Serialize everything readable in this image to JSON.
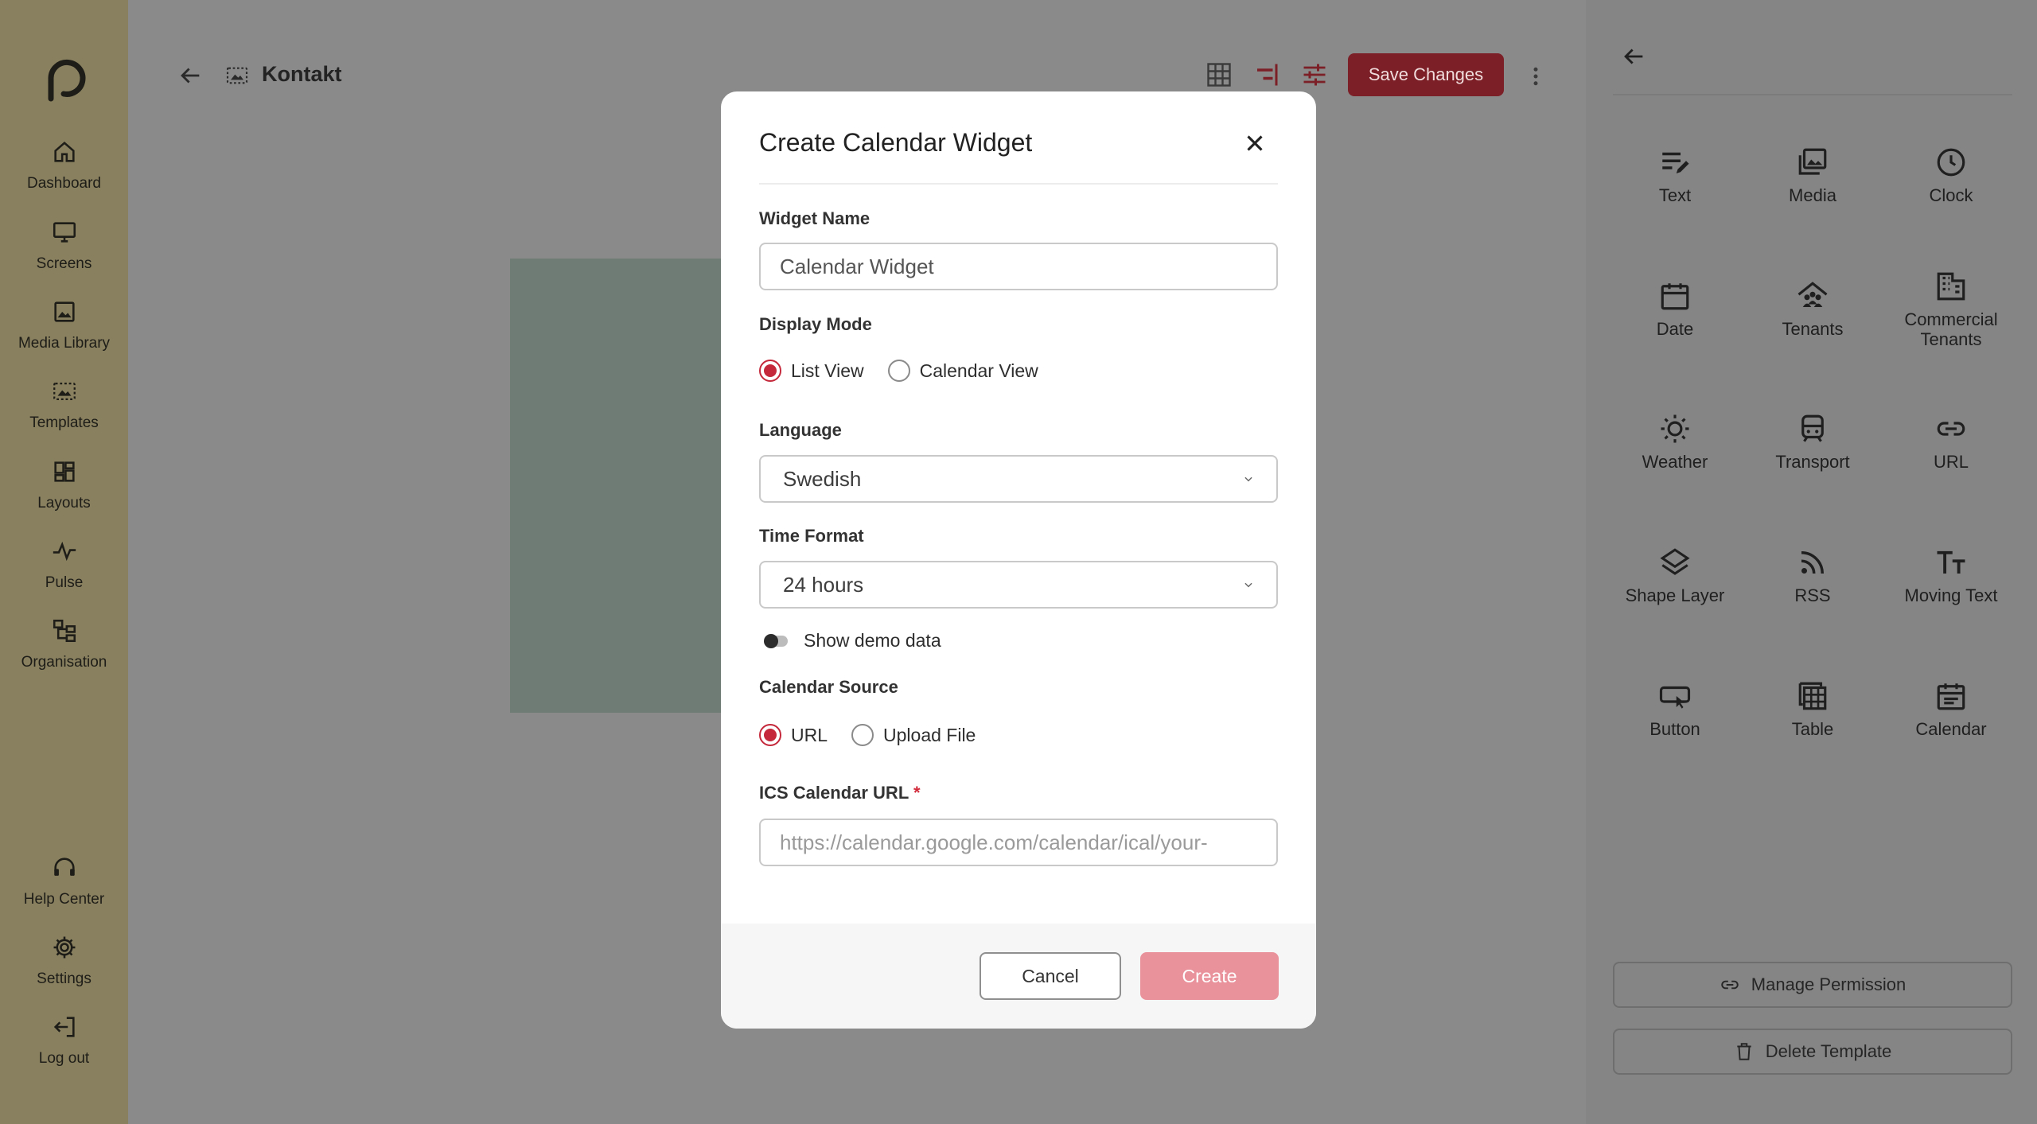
{
  "sidebar": {
    "items": [
      {
        "label": "Dashboard",
        "icon": "home-icon"
      },
      {
        "label": "Screens",
        "icon": "monitor-icon"
      },
      {
        "label": "Media Library",
        "icon": "image-icon"
      },
      {
        "label": "Templates",
        "icon": "template-icon"
      },
      {
        "label": "Layouts",
        "icon": "layout-grid-icon"
      },
      {
        "label": "Pulse",
        "icon": "pulse-icon"
      },
      {
        "label": "Organisation",
        "icon": "org-chart-icon"
      }
    ],
    "bottom_items": [
      {
        "label": "Help Center",
        "icon": "headset-icon"
      },
      {
        "label": "Settings",
        "icon": "gear-icon"
      },
      {
        "label": "Log out",
        "icon": "logout-icon"
      }
    ]
  },
  "header": {
    "title": "Kontakt",
    "save_label": "Save Changes",
    "accent": "#7c1f27"
  },
  "right_panel": {
    "widgets": [
      {
        "label": "Text",
        "icon": "text-edit-icon"
      },
      {
        "label": "Media",
        "icon": "photos-icon"
      },
      {
        "label": "Clock",
        "icon": "clock-icon"
      },
      {
        "label": "Date",
        "icon": "calendar-date-icon"
      },
      {
        "label": "Tenants",
        "icon": "tenants-icon"
      },
      {
        "label": "Commercial Tenants",
        "icon": "building-icon"
      },
      {
        "label": "Weather",
        "icon": "sun-icon"
      },
      {
        "label": "Transport",
        "icon": "train-icon"
      },
      {
        "label": "URL",
        "icon": "link-icon"
      },
      {
        "label": "Shape Layer",
        "icon": "layers-icon"
      },
      {
        "label": "RSS",
        "icon": "rss-icon"
      },
      {
        "label": "Moving Text",
        "icon": "text-size-icon"
      },
      {
        "label": "Button",
        "icon": "button-icon"
      },
      {
        "label": "Table",
        "icon": "table-icon"
      },
      {
        "label": "Calendar",
        "icon": "calendar-icon"
      }
    ],
    "manage_permission_label": "Manage Permission",
    "delete_template_label": "Delete Template"
  },
  "modal": {
    "title": "Create Calendar Widget",
    "widget_name_label": "Widget Name",
    "widget_name_value": "Calendar Widget",
    "display_mode_label": "Display Mode",
    "display_modes": [
      "List View",
      "Calendar View"
    ],
    "display_mode_selected": "List View",
    "language_label": "Language",
    "language_value": "Swedish",
    "time_format_label": "Time Format",
    "time_format_value": "24 hours",
    "demo_toggle_label": "Show demo data",
    "demo_toggle_on": false,
    "calendar_source_label": "Calendar Source",
    "calendar_sources": [
      "URL",
      "Upload File"
    ],
    "calendar_source_selected": "URL",
    "ics_url_label": "ICS Calendar URL",
    "ics_url_required_mark": "*",
    "ics_url_placeholder": "https://calendar.google.com/calendar/ical/your-",
    "cancel_label": "Cancel",
    "create_label": "Create",
    "accent": "#c4283a"
  }
}
